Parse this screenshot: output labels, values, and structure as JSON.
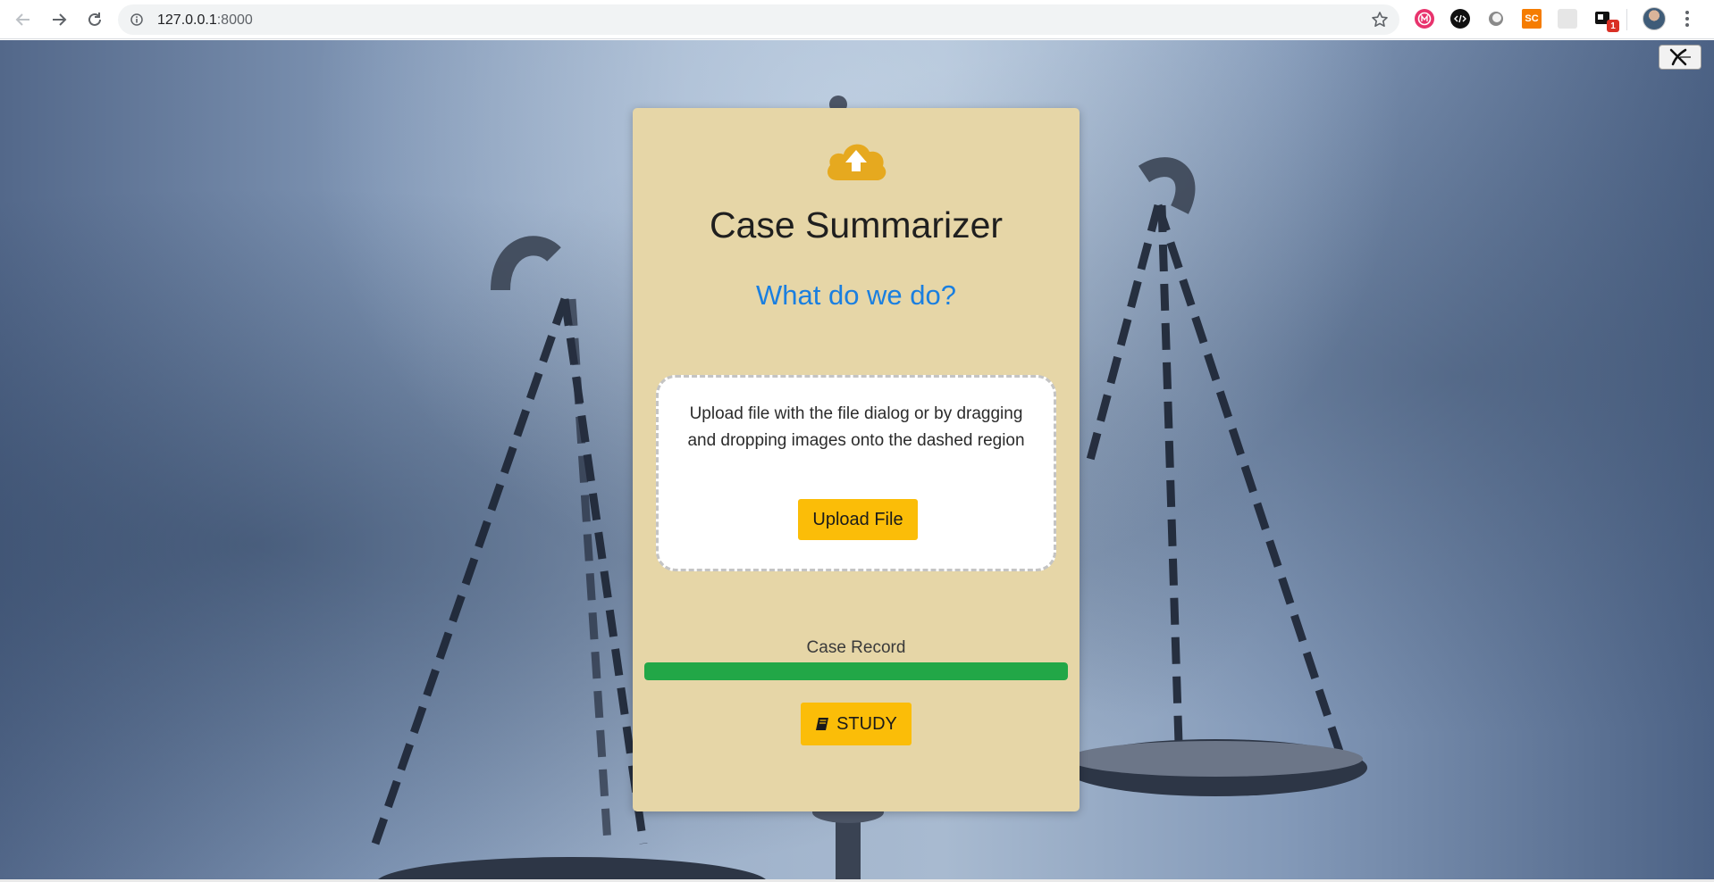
{
  "browser": {
    "url_host": "127.0.0.1",
    "url_port": ":8000",
    "icons": {
      "back": "back-arrow-icon",
      "forward": "forward-arrow-icon",
      "reload": "reload-icon",
      "info": "site-info-icon",
      "bookmark": "bookmark-star-icon",
      "menu": "browser-menu-icon"
    },
    "extensions": [
      {
        "name": "m-extension-icon",
        "label": "m",
        "color": "#e8336d"
      },
      {
        "name": "code-extension-icon",
        "label": "</>",
        "color": "#111111"
      },
      {
        "name": "circle-extension-icon",
        "label": "",
        "color": "#777777"
      },
      {
        "name": "sc-extension-icon",
        "label": "SC",
        "color": "#f57c00"
      },
      {
        "name": "blank-extension-icon",
        "label": "",
        "color": "#e0e0e0"
      },
      {
        "name": "notification-extension-icon",
        "label": "",
        "color": "#111111"
      }
    ],
    "extension_badge": "1"
  },
  "page": {
    "close_icon": "close-x-icon",
    "card": {
      "icon": "cloud-upload-icon",
      "title": "Case Summarizer",
      "subtitle": "What do we do?",
      "dropzone_text": "Upload file with the file dialog or by dragging and dropping images onto the dashed region",
      "upload_button": "Upload File",
      "progress_label": "Case Record",
      "progress_value": 1.0,
      "study_button": "STUDY",
      "study_icon": "book-icon"
    }
  },
  "colors": {
    "card_background": "#e6d6a7",
    "accent_yellow": "#fbbd08",
    "link_blue": "#1a7fe0",
    "progress_green": "#22a747",
    "icon_gold": "#e6a91f"
  }
}
